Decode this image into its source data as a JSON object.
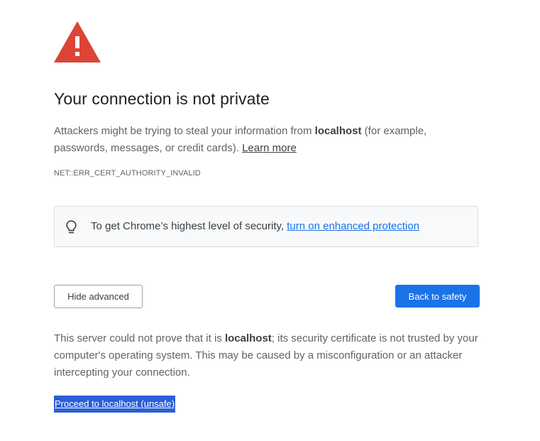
{
  "icons": {
    "warning": "warning-triangle-icon",
    "bulb": "lightbulb-icon"
  },
  "colors": {
    "warning_red": "#db4437",
    "accent_blue": "#1a73e8",
    "selection_blue": "#2b5fd9",
    "promo_background": "#f8f9fa",
    "body_text": "#5f6368",
    "heading_text": "#202124"
  },
  "heading": {
    "title": "Your connection is not private"
  },
  "description": {
    "prefix": "Attackers might be trying to steal your information from ",
    "host": "localhost",
    "suffix": " (for example, passwords, messages, or credit cards). ",
    "learn_more": "Learn more"
  },
  "error_code": "NET::ERR_CERT_AUTHORITY_INVALID",
  "promo": {
    "text": "To get Chrome’s highest level of security, ",
    "link": "turn on enhanced protection"
  },
  "buttons": {
    "hide_advanced": "Hide advanced",
    "back_to_safety": "Back to safety"
  },
  "details": {
    "prefix": "This server could not prove that it is ",
    "host": "localhost",
    "suffix": "; its security certificate is not trusted by your computer's operating system. This may be caused by a misconfiguration or an attacker intercepting your connection."
  },
  "proceed_link": "Proceed to localhost (unsafe)"
}
